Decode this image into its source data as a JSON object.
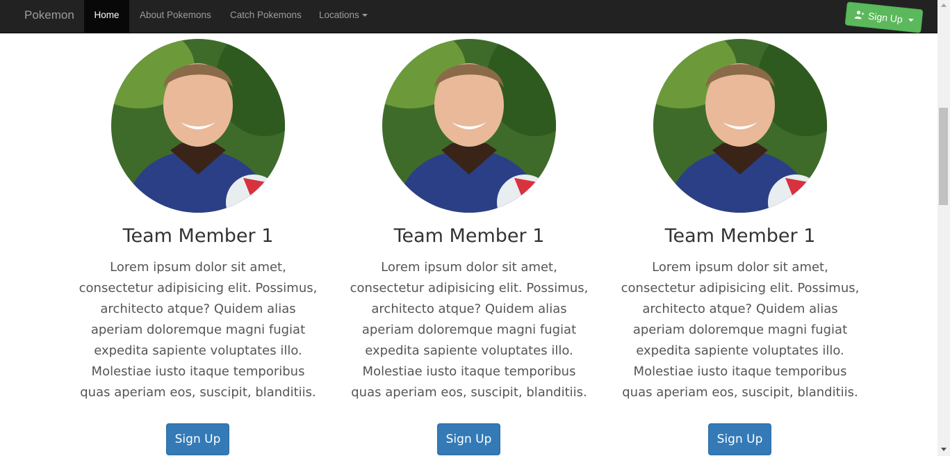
{
  "navbar": {
    "brand": "Pokemon",
    "items": [
      {
        "label": "Home",
        "active": true
      },
      {
        "label": "About Pokemons",
        "active": false
      },
      {
        "label": "Catch Pokemons",
        "active": false
      },
      {
        "label": "Locations",
        "active": false,
        "dropdown": true
      }
    ],
    "signup_label": "Sign Up",
    "signup_icon": "user-plus-icon"
  },
  "members": [
    {
      "name": "Team Member 1",
      "description": "Lorem ipsum dolor sit amet, consectetur adipisicing elit. Possimus, architecto atque? Quidem alias aperiam doloremque magni fugiat expedita sapiente voluptates illo. Molestiae iusto itaque temporibus quas aperiam eos, suscipit, blanditiis.",
      "button_label": "Sign Up"
    },
    {
      "name": "Team Member 1",
      "description": "Lorem ipsum dolor sit amet, consectetur adipisicing elit. Possimus, architecto atque? Quidem alias aperiam doloremque magni fugiat expedita sapiente voluptates illo. Molestiae iusto itaque temporibus quas aperiam eos, suscipit, blanditiis.",
      "button_label": "Sign Up"
    },
    {
      "name": "Team Member 1",
      "description": "Lorem ipsum dolor sit amet, consectetur adipisicing elit. Possimus, architecto atque? Quidem alias aperiam doloremque magni fugiat expedita sapiente voluptates illo. Molestiae iusto itaque temporibus quas aperiam eos, suscipit, blanditiis.",
      "button_label": "Sign Up"
    }
  ],
  "colors": {
    "navbar_bg": "#222222",
    "signup_green": "#5cb85c",
    "button_blue": "#337ab7"
  }
}
